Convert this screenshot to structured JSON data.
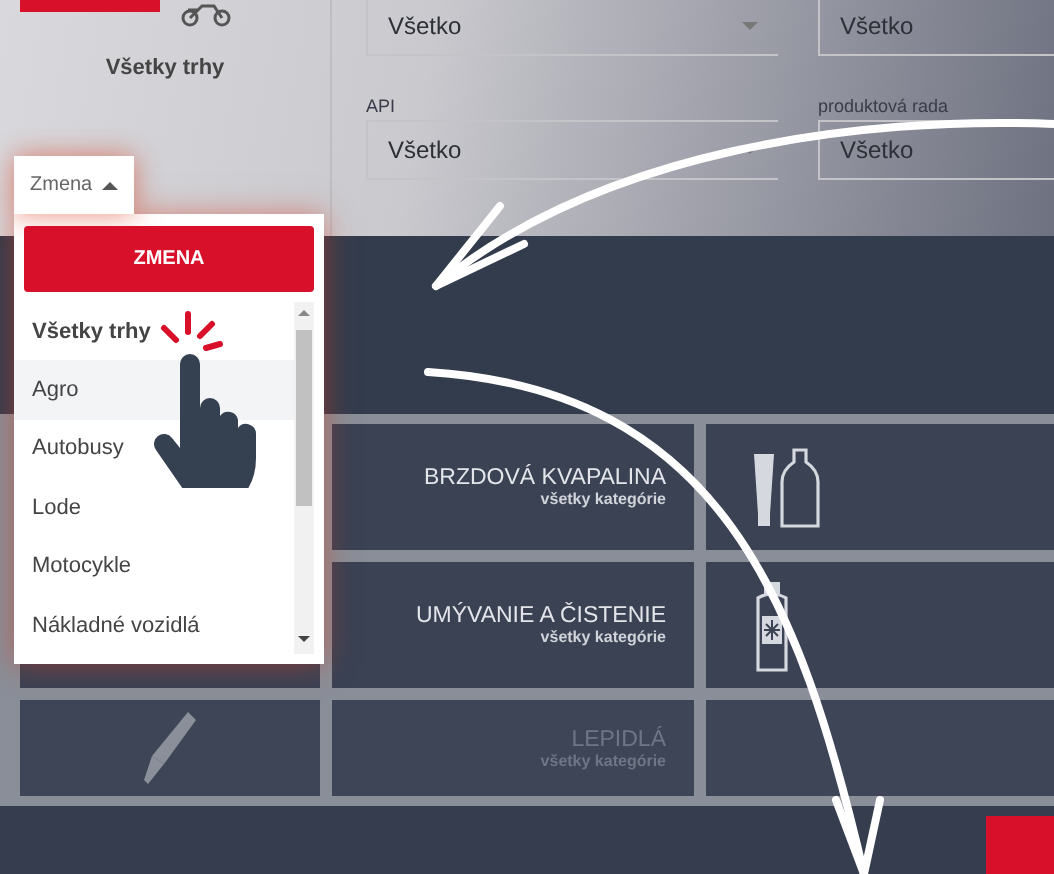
{
  "sidebar": {
    "label": "Všetky trhy"
  },
  "filters": [
    {
      "value": "Všetko"
    },
    {
      "value": "Všetko"
    },
    {
      "label": "API",
      "value": "Všetko"
    },
    {
      "label": "produktová rada",
      "value": "Všetko"
    }
  ],
  "dropdown": {
    "toggle": "Zmena",
    "expanded": true,
    "button": "ZMENA",
    "items": [
      {
        "label": "Všetky trhy",
        "selected": true,
        "hovered": false
      },
      {
        "label": "Agro",
        "selected": false,
        "hovered": true
      },
      {
        "label": "Autobusy",
        "selected": false,
        "hovered": false
      },
      {
        "label": "Lode",
        "selected": false,
        "hovered": false
      },
      {
        "label": "Motocykle",
        "selected": false,
        "hovered": false
      },
      {
        "label": "Nákladné vozidlá",
        "selected": false,
        "hovered": false
      }
    ]
  },
  "categories": [
    {
      "title": "BRZDOVÁ KVAPALINA",
      "subtitle": "všetky kategórie",
      "kind": "icon-right",
      "dimmed": false
    },
    {
      "title": "UMÝVANIE A ČISTENIE",
      "subtitle": "všetky kategórie",
      "kind": "icon-right",
      "dimmed": false
    },
    {
      "title": "LEPIDLÁ",
      "subtitle": "všetky kategórie",
      "kind": "icon-left",
      "dimmed": true
    }
  ]
}
